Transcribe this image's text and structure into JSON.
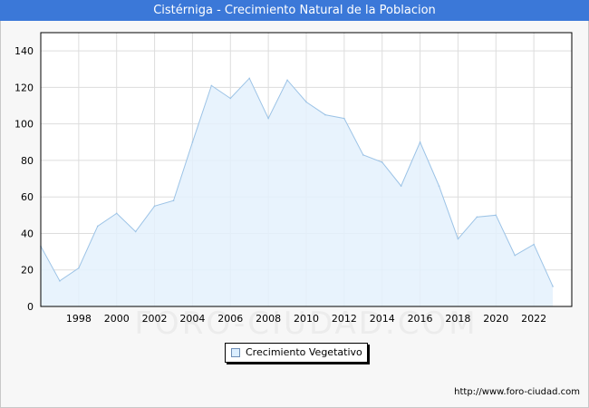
{
  "chart_data": {
    "type": "area",
    "title": "Cistérniga - Crecimiento Natural de la Poblacion",
    "xlabel": "",
    "ylabel": "",
    "x": [
      1996,
      1997,
      1998,
      1999,
      2000,
      2001,
      2002,
      2003,
      2004,
      2005,
      2006,
      2007,
      2008,
      2009,
      2010,
      2011,
      2012,
      2013,
      2014,
      2015,
      2016,
      2017,
      2018,
      2019,
      2020,
      2021,
      2022,
      2023
    ],
    "series": [
      {
        "name": "Crecimiento Vegetativo",
        "values": [
          33,
          14,
          21,
          44,
          51,
          41,
          55,
          58,
          90,
          121,
          114,
          125,
          103,
          124,
          112,
          105,
          103,
          83,
          79,
          66,
          90,
          66,
          37,
          49,
          50,
          28,
          34,
          11
        ],
        "line_color": "#9cc3e6",
        "fill_color": "#e4f1fd"
      }
    ],
    "x_tick_labels": [
      "1998",
      "2000",
      "2002",
      "2004",
      "2006",
      "2008",
      "2010",
      "2012",
      "2014",
      "2016",
      "2018",
      "2020",
      "2022"
    ],
    "y_tick_labels": [
      "0",
      "20",
      "40",
      "60",
      "80",
      "100",
      "120",
      "140"
    ],
    "xlim": [
      1996,
      2024
    ],
    "ylim": [
      0,
      150
    ],
    "grid": true,
    "legend_position": "bottom-center",
    "watermark": "FORO-CIUDAD.COM"
  },
  "page": {
    "title": "Cistérniga - Crecimiento Natural de la Poblacion",
    "legend_label": "Crecimiento Vegetativo",
    "url": "http://www.foro-ciudad.com",
    "title_bar_color": "#3b78d8"
  }
}
